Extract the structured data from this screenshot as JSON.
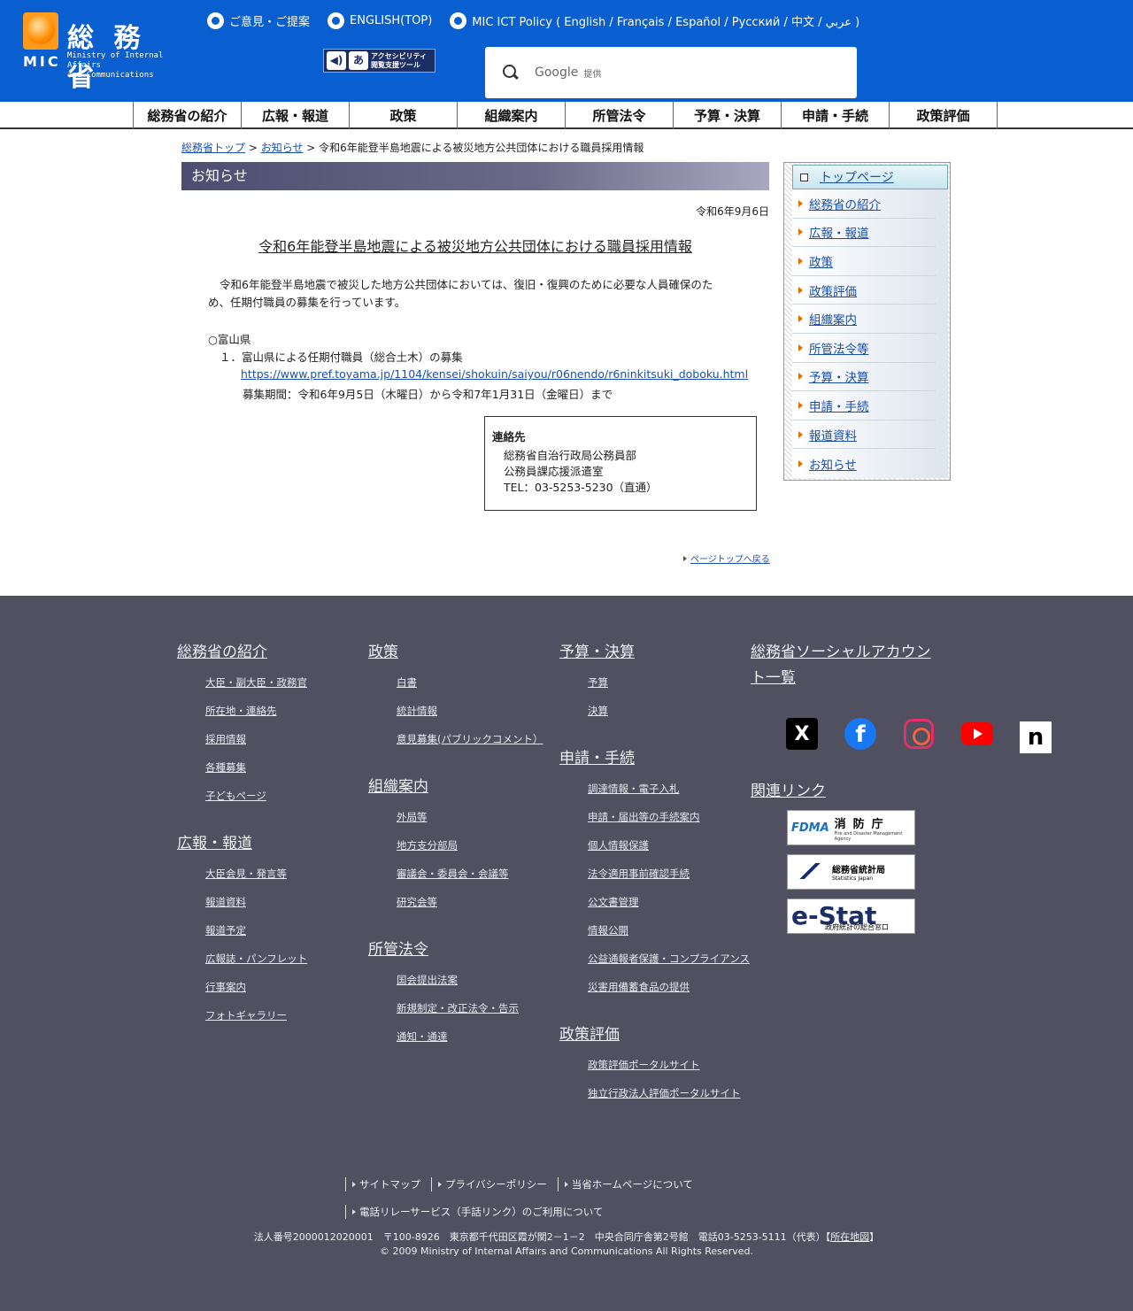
{
  "header": {
    "logo_kanji": "総 務 省",
    "logo_mic": "MIC",
    "logo_en_line1": "Ministry of Internal Affairs",
    "logo_en_line2": "and Communications",
    "toplinks": [
      {
        "label": "ご意見・ご提案"
      },
      {
        "label": "ENGLISH(TOP)"
      },
      {
        "label": "MIC ICT Policy ( English / Français / Español / Русский / 中文 / عربي )"
      }
    ],
    "access_tool": {
      "line1": "アクセシビリティ",
      "line2": "閲覧支援ツール",
      "glyph": "あ"
    },
    "search": {
      "google": "Google",
      "provided": "提供"
    }
  },
  "gnav": [
    {
      "label": "総務省の紹介"
    },
    {
      "label": "広報・報道"
    },
    {
      "label": "政策"
    },
    {
      "label": "組織案内"
    },
    {
      "label": "所管法令"
    },
    {
      "label": "予算・決算"
    },
    {
      "label": "申請・手続"
    },
    {
      "label": "政策評価"
    }
  ],
  "breadcrumb": {
    "home": "総務省トップ",
    "sep1": " > ",
    "notice": "お知らせ",
    "sep2": " > ",
    "current": "令和6年能登半島地震による被災地方公共団体における職員採用情報"
  },
  "main": {
    "section_title": "お知らせ",
    "date": "令和6年9月6日",
    "title": "令和6年能登半島地震による被災地方公共団体における職員採用情報",
    "body_line1": "令和6年能登半島地震で被災した地方公共団体においては、復旧・復興のために必要な人員確保のた",
    "body_line2": "め、任期付職員の募集を行っています。",
    "prefecture": "○富山県",
    "recruit_item": "１．富山県による任期付職員（総合土木）の募集",
    "recruit_url": "https://www.pref.toyama.jp/1104/kensei/shokuin/saiyou/r06nendo/r6ninkitsuki_doboku.html",
    "recruit_period": "募集期間：令和6年9月5日（木曜日）から令和7年1月31日（金曜日）まで",
    "contact": {
      "title": "連絡先",
      "line1": "総務省自治行政局公務員部",
      "line2": "公務員課応援派遣室",
      "line3": "TEL：03-5253-5230（直通）"
    },
    "pagetop": "ページトップへ戻る"
  },
  "sidebar": {
    "top": "トップページ",
    "items": [
      {
        "label": "総務省の紹介"
      },
      {
        "label": "広報・報道"
      },
      {
        "label": "政策"
      },
      {
        "label": "政策評価"
      },
      {
        "label": "組織案内"
      },
      {
        "label": "所管法令等"
      },
      {
        "label": "予算・決算"
      },
      {
        "label": "申請・手続"
      },
      {
        "label": "報道資料"
      },
      {
        "label": "お知らせ"
      }
    ]
  },
  "footer": {
    "col1": [
      {
        "head": "総務省の紹介",
        "links": [
          "大臣・副大臣・政務官",
          "所在地・連絡先",
          "採用情報",
          "各種募集",
          "子どもページ"
        ]
      },
      {
        "head": "広報・報道",
        "links": [
          "大臣会見・発言等",
          "報道資料",
          "報道予定",
          "広報誌・パンフレット",
          "行事案内",
          "フォトギャラリー"
        ]
      }
    ],
    "col2": [
      {
        "head": "政策",
        "links": [
          "白書",
          "統計情報",
          "意見募集(パブリックコメント）"
        ]
      },
      {
        "head": "組織案内",
        "links": [
          "外局等",
          "地方支分部局",
          "審議会・委員会・会議等",
          "研究会等"
        ]
      },
      {
        "head": "所管法令",
        "links": [
          "国会提出法案",
          "新規制定・改正法令・告示",
          "通知・通達"
        ]
      }
    ],
    "col3": [
      {
        "head": "予算・決算",
        "links": [
          "予算",
          "決算"
        ]
      },
      {
        "head": "申請・手続",
        "links": [
          "調達情報・電子入札",
          "申請・届出等の手続案内",
          "個人情報保護",
          "法令適用事前確認手続",
          "公文書管理",
          "情報公開",
          "公益通報者保護・コンプライアンス",
          "災害用備蓄食品の提供"
        ]
      },
      {
        "head": "政策評価",
        "links": [
          "政策評価ポータルサイト",
          "独立行政法人評価ポータルサイト"
        ]
      }
    ],
    "social_head_line1": "総務省ソーシャルアカウン",
    "social_head_line2": "ト一覧",
    "social": [
      "x-icon",
      "facebook-icon",
      "instagram-icon",
      "youtube-icon",
      "note-icon"
    ],
    "social_glyph_x": "X",
    "social_glyph_fb": "f",
    "social_glyph_note": "n",
    "related_head": "関連リンク",
    "related": {
      "fdma_logo": "FDMA",
      "fdma_ja": "消防庁",
      "fdma_en": "Fire and Disaster Management Agency",
      "stat_ja": "総務省統計局",
      "stat_en": "Statistics Japan",
      "estat": "e-Stat",
      "estat_sub": "政府統計の総合窓口"
    },
    "bottom_links_row1": [
      "サイトマップ",
      "プライバシーポリシー",
      "当省ホームページについて"
    ],
    "bottom_links_row2": [
      "電話リレーサービス（手話リンク）のご利用について"
    ],
    "corp_line1_pre": "法人番号2000012020001　〒100-8926　東京都千代田区霞が関2－1－2　中央合同庁舎第2号館　電話03-5253-5111（代表）【",
    "corp_map": "所在地図",
    "corp_line1_post": "】",
    "copyright": "© 2009 Ministry of Internal Affairs and Communications All Rights Reserved."
  }
}
